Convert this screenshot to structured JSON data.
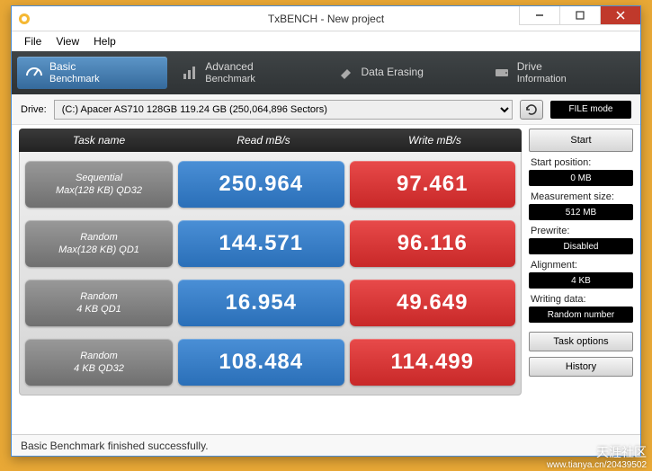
{
  "window": {
    "title": "TxBENCH - New project"
  },
  "menu": {
    "file": "File",
    "view": "View",
    "help": "Help"
  },
  "tabs": {
    "basic": {
      "line1": "Basic",
      "line2": "Benchmark"
    },
    "advanced": {
      "line1": "Advanced",
      "line2": "Benchmark"
    },
    "erase": {
      "line1": "Data Erasing"
    },
    "drive": {
      "line1": "Drive",
      "line2": "Information"
    }
  },
  "drivebar": {
    "label": "Drive:",
    "selected": "(C:) Apacer AS710 128GB  119.24 GB (250,064,896 Sectors)",
    "filemode": "FILE mode"
  },
  "headers": {
    "task": "Task name",
    "read": "Read mB/s",
    "write": "Write mB/s"
  },
  "rows": [
    {
      "name1": "Sequential",
      "name2": "Max(128 KB) QD32",
      "read": "250.964",
      "write": "97.461"
    },
    {
      "name1": "Random",
      "name2": "Max(128 KB) QD1",
      "read": "144.571",
      "write": "96.116"
    },
    {
      "name1": "Random",
      "name2": "4 KB QD1",
      "read": "16.954",
      "write": "49.649"
    },
    {
      "name1": "Random",
      "name2": "4 KB QD32",
      "read": "108.484",
      "write": "114.499"
    }
  ],
  "side": {
    "start": "Start",
    "startpos_label": "Start position:",
    "startpos_value": "0 MB",
    "meassize_label": "Measurement size:",
    "meassize_value": "512 MB",
    "prewrite_label": "Prewrite:",
    "prewrite_value": "Disabled",
    "align_label": "Alignment:",
    "align_value": "4 KB",
    "writing_label": "Writing data:",
    "writing_value": "Random number",
    "taskopt": "Task options",
    "history": "History"
  },
  "status": "Basic Benchmark finished successfully.",
  "watermark": {
    "main": "天涯社区",
    "sub": "www.tianya.cn/20439502"
  }
}
